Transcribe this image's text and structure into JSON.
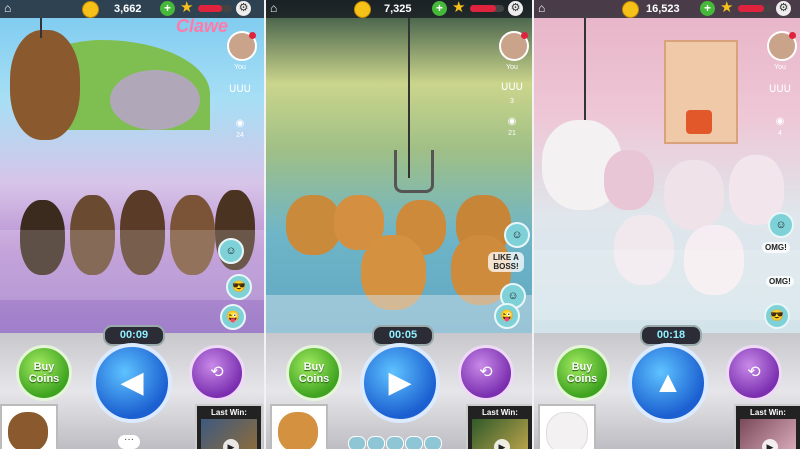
{
  "panels": [
    {
      "coins": "3,662",
      "timer": "00:09",
      "buy_label": "Buy Coins",
      "direction_icon": "left-arrow",
      "viewers_label": "You",
      "viewers_count": "24",
      "last_win_label": "Last Win:",
      "sign_text": "Clawe"
    },
    {
      "coins": "7,325",
      "timer": "00:05",
      "buy_label": "Buy Coins",
      "direction_icon": "right-arrow",
      "viewers_label": "You",
      "players_count": "3",
      "viewers_count": "21",
      "last_win_label": "Last Win:",
      "bubble_text": "LIKE A BOSS!"
    },
    {
      "coins": "16,523",
      "timer": "00:18",
      "buy_label": "Buy Coins",
      "direction_icon": "up-arrow",
      "viewers_label": "You",
      "viewers_count": "4",
      "last_win_label": "Last Win:",
      "bubble_omg_1": "OMG!",
      "bubble_omg_2": "OMG!"
    }
  ],
  "xp_level": [
    0.7,
    0.75,
    0.75
  ],
  "colors": {
    "buy_button": "#3ea31f",
    "direction_button": "#1b5fd1",
    "camera_button": "#7b2fb0",
    "coin": "#f6c21a",
    "xp_bar": "#e0233d"
  }
}
